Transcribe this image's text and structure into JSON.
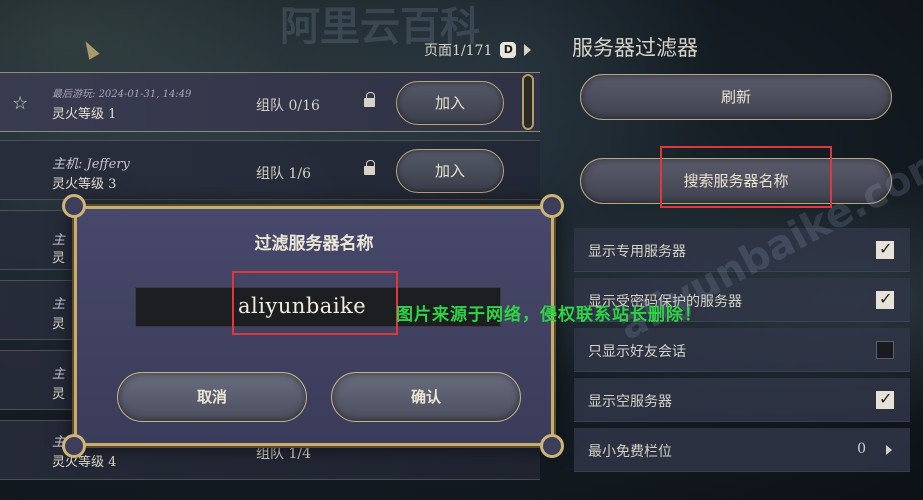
{
  "header": {
    "page_indicator": "页面1/171",
    "page_key_hint": "D"
  },
  "servers": [
    {
      "host_prefix": "最后游玩:",
      "host_value": "2024-01-31, 14:49",
      "name": "灵火等级 1",
      "team": "组队 0/16",
      "join_label": "加入",
      "favorite_icon": "star-icon",
      "locked": true
    },
    {
      "host_prefix": "主机:",
      "host_value": "Jeffery",
      "name": "灵火等级 3",
      "team": "组队 1/6",
      "join_label": "加入",
      "locked": true
    },
    {
      "host_prefix": "主",
      "name": "灵",
      "team": "",
      "join_label": ""
    },
    {
      "host_prefix": "主",
      "name": "灵",
      "team": "",
      "join_label": ""
    },
    {
      "host_prefix": "主",
      "name": "灵",
      "team": "",
      "join_label": ""
    },
    {
      "host_prefix": "主",
      "name": "灵火等级 4",
      "team": "组队 1/4",
      "join_label": ""
    }
  ],
  "filter_panel": {
    "title": "服务器过滤器",
    "refresh_label": "刷新",
    "search_label": "搜索服务器名称",
    "options": [
      {
        "label": "显示专用服务器",
        "checked": true
      },
      {
        "label": "显示受密码保护的服务器",
        "checked": true
      },
      {
        "label": "只显示好友会话",
        "checked": false
      },
      {
        "label": "显示空服务器",
        "checked": true
      }
    ],
    "min_free_slots": {
      "label": "最小免费栏位",
      "value": "0"
    }
  },
  "modal": {
    "title": "过滤服务器名称",
    "input_value": "aliyunbaike",
    "cancel_label": "取消",
    "confirm_label": "确认"
  },
  "watermark": {
    "green_text": "图片来源于网络，侵权联系站长删除！",
    "ghost_top": "阿里云百科",
    "ghost_diag": "aliyunbaike.com"
  },
  "colors": {
    "gold_border": "#c7ae6e",
    "highlight_red": "#e0373a",
    "watermark_green": "#2fd446"
  }
}
